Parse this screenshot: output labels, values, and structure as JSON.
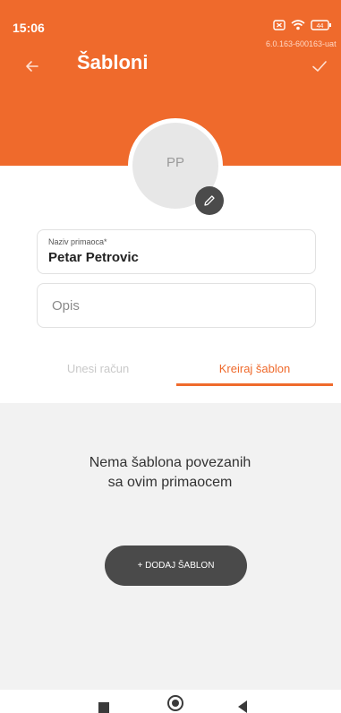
{
  "status_bar": {
    "time": "15:06",
    "battery": "44",
    "version": "6.0.163-600163-uat"
  },
  "header": {
    "title": "Šabloni",
    "accent_color": "#ef6a2c"
  },
  "avatar": {
    "initials": "PP"
  },
  "form": {
    "recipient_label": "Naziv primaoca*",
    "recipient_value": "Petar Petrovic",
    "description_placeholder": "Opis"
  },
  "tabs": [
    {
      "label": "Unesi račun",
      "active": false
    },
    {
      "label": "Kreiraj šablon",
      "active": true
    }
  ],
  "empty_state": {
    "message": "Nema šablona povezanih sa ovim primaocem",
    "add_button_label": "+ DODAJ ŠABLON"
  }
}
